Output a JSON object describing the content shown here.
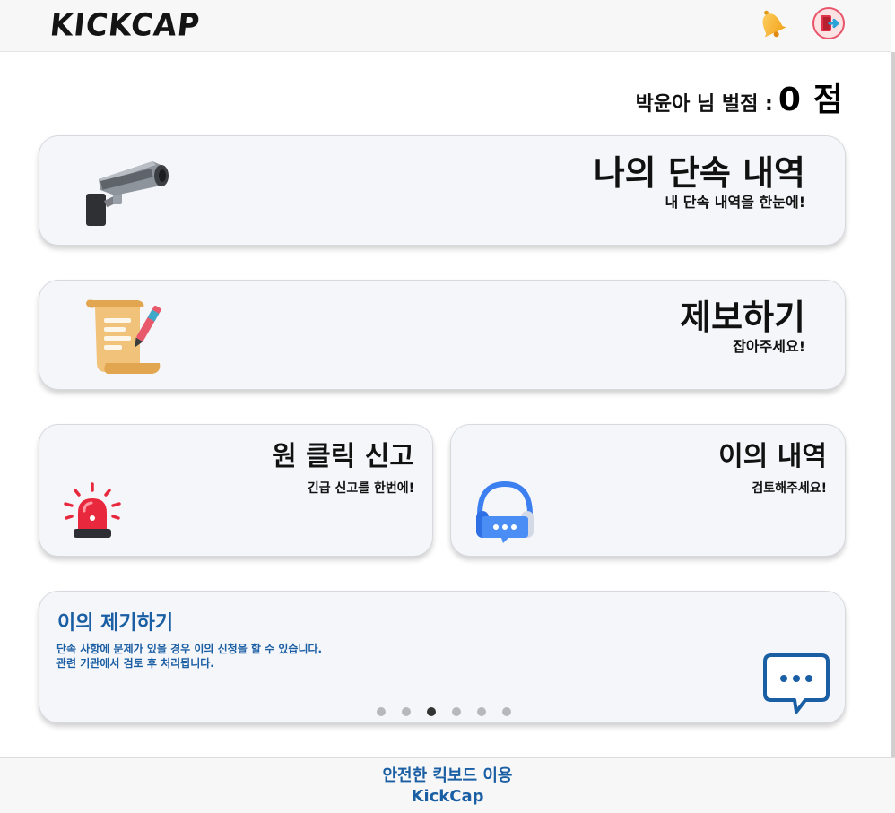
{
  "header": {
    "logo": "KICKCAP",
    "bell_icon": "bell-icon",
    "logout_icon": "logout-icon"
  },
  "penalty": {
    "label": "박윤아 님 벌점 :",
    "value": "0",
    "unit": "점"
  },
  "cards": [
    {
      "title": "나의 단속 내역",
      "subtitle": "내 단속 내역을 한눈에!",
      "icon": "cctv-camera-icon"
    },
    {
      "title": "제보하기",
      "subtitle": "잡아주세요!",
      "icon": "scroll-pen-icon"
    },
    {
      "title": "원 클릭 신고",
      "subtitle": "긴급 신고를 한번에!",
      "icon": "siren-icon"
    },
    {
      "title": "이의 내역",
      "subtitle": "검토해주세요!",
      "icon": "headset-chat-icon"
    }
  ],
  "banner": {
    "title": "이의 제기하기",
    "line1": "단속 사항에 문제가 있을 경우 이의 신청을 할 수 있습니다.",
    "line2": "관련 기관에서 검토 후 처리됩니다.",
    "icon": "chat-bubble-icon",
    "slide_count": 6,
    "active_slide": 3
  },
  "footer": {
    "line1": "안전한 킥보드 이용",
    "line2": "KickCap"
  },
  "colors": {
    "accent_blue": "#1a5ea3",
    "card_bg": "#f5f6fa",
    "siren_red": "#e8283c"
  }
}
